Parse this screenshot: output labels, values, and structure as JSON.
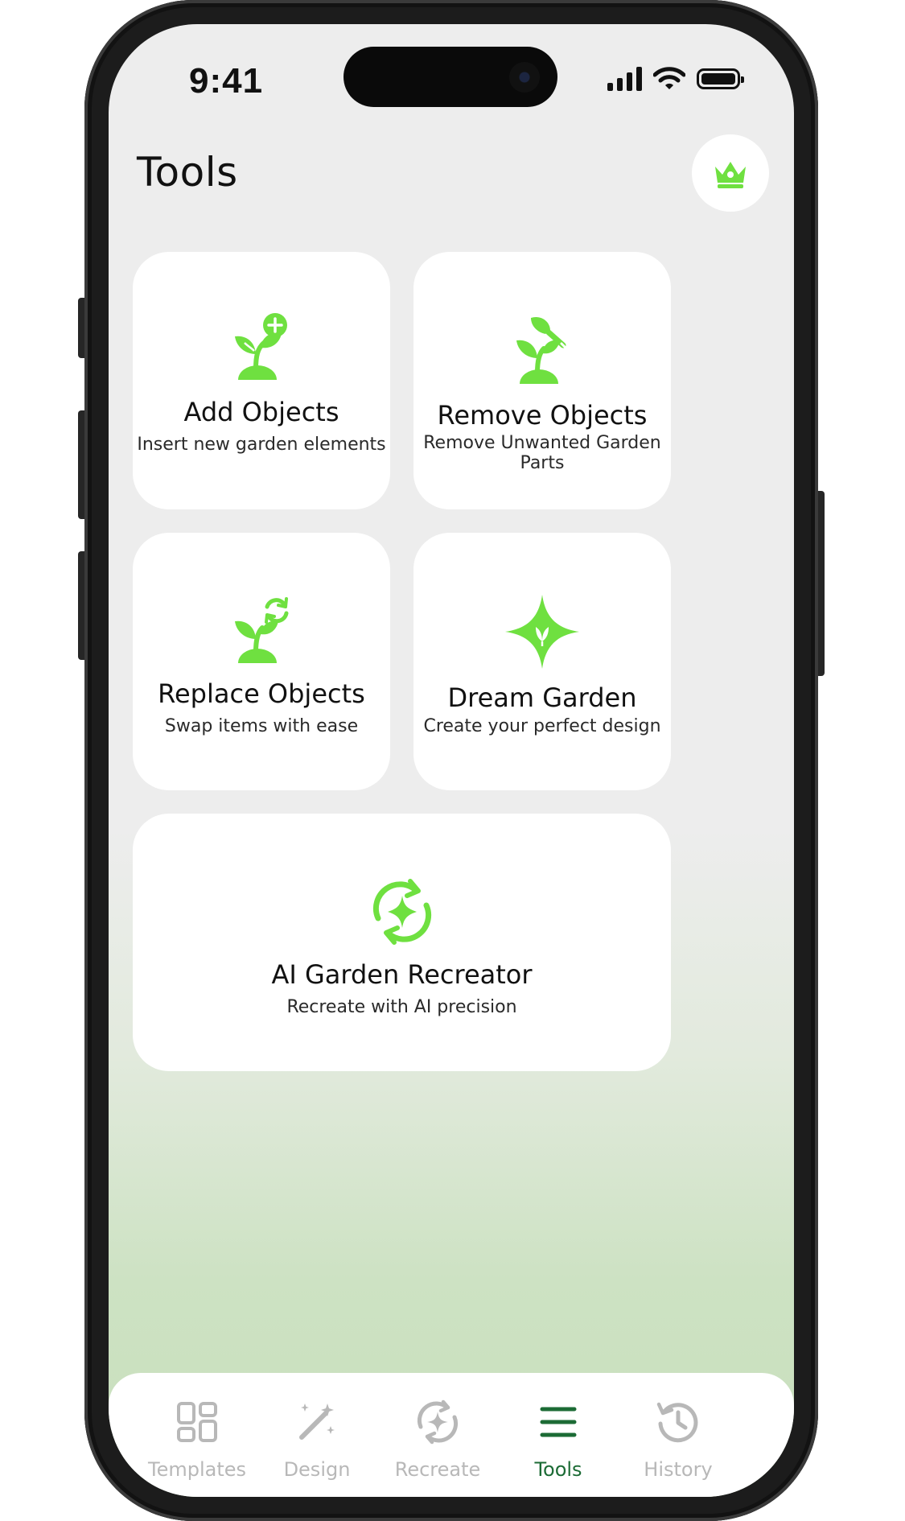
{
  "status_bar": {
    "time": "9:41"
  },
  "header": {
    "title": "Tools"
  },
  "cards": [
    {
      "title": "Add Objects",
      "subtitle": "Insert new garden elements",
      "icon": "sprout-plus-icon"
    },
    {
      "title": "Remove Objects",
      "subtitle": "Remove Unwanted Garden Parts",
      "icon": "sprout-trowel-icon"
    },
    {
      "title": "Replace Objects",
      "subtitle": "Swap items with ease",
      "icon": "sprout-refresh-icon"
    },
    {
      "title": "Dream Garden",
      "subtitle": "Create your perfect design",
      "icon": "sparkle-leaf-icon"
    },
    {
      "title": "AI Garden Recreator",
      "subtitle": "Recreate with AI precision",
      "icon": "ai-refresh-sparkle-icon"
    }
  ],
  "tabbar": {
    "active": "Tools",
    "items": [
      {
        "label": "Templates",
        "icon": "grid-icon"
      },
      {
        "label": "Design",
        "icon": "magic-wand-icon"
      },
      {
        "label": "Recreate",
        "icon": "refresh-sparkle-icon"
      },
      {
        "label": "Tools",
        "icon": "menu-icon"
      },
      {
        "label": "History",
        "icon": "history-icon"
      }
    ]
  },
  "colors": {
    "accent_green": "#6fe040",
    "active_tab": "#1c6b35",
    "inactive_tab": "#b8b8b8",
    "background": "#ededed"
  }
}
